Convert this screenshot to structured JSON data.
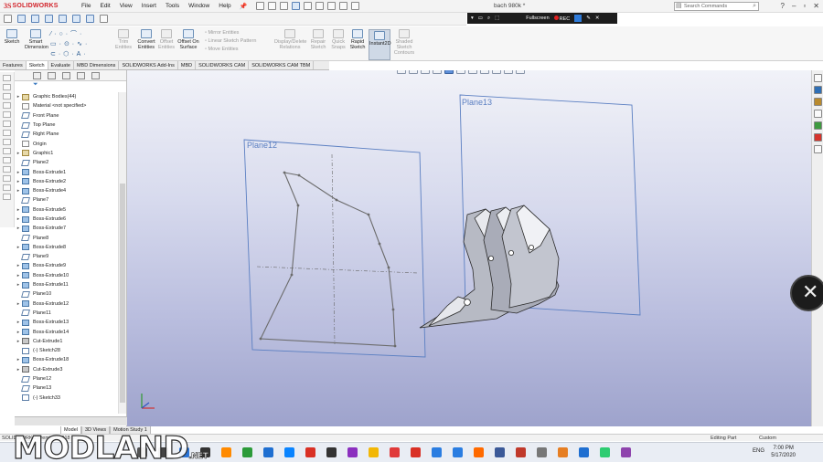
{
  "app": {
    "logo_ds": "3S",
    "logo_name": "SOLIDWORKS",
    "document_title": "bach 980k *",
    "menus": [
      "File",
      "Edit",
      "View",
      "Insert",
      "Tools",
      "Window",
      "Help"
    ],
    "search_placeholder": "Search Commands",
    "window_controls": [
      "?",
      "–",
      "▫",
      "✕"
    ]
  },
  "recorder": {
    "fullscreen_label": "Fullscreen",
    "rec_label": "REC"
  },
  "command_manager": {
    "tools": [
      {
        "id": "sketch",
        "label": "Sketch",
        "dim": false
      },
      {
        "id": "smart-dimension",
        "label": "Smart Dimension",
        "dim": false
      },
      {
        "id": "trim-entities",
        "label": "Trim Entities",
        "dim": true
      },
      {
        "id": "convert-entities",
        "label": "Convert Entities",
        "dim": false
      },
      {
        "id": "offset-entities",
        "label": "Offset Entities",
        "dim": true
      },
      {
        "id": "offset-on-surface",
        "label": "Offset On Surface",
        "dim": false
      },
      {
        "id": "display-delete-relations",
        "label": "Display/Delete Relations",
        "dim": true
      },
      {
        "id": "repair-sketch",
        "label": "Repair Sketch",
        "dim": true
      },
      {
        "id": "quick-snaps",
        "label": "Quick Snaps",
        "dim": true
      },
      {
        "id": "rapid-sketch",
        "label": "Rapid Sketch",
        "dim": false
      },
      {
        "id": "instant2d",
        "label": "Instant2D",
        "dim": false
      },
      {
        "id": "shaded-sketch-contours",
        "label": "Shaded Sketch Contours",
        "dim": true
      }
    ],
    "small_tools": [
      "Mirror Entities",
      "Linear Sketch Pattern",
      "Move Entities"
    ]
  },
  "tabs": [
    "Features",
    "Sketch",
    "Evaluate",
    "MBD Dimensions",
    "SOLIDWORKS Add-Ins",
    "MBD",
    "SOLIDWORKS CAM",
    "SOLIDWORKS CAM TBM"
  ],
  "active_tab": "Sketch",
  "feature_tree": [
    {
      "label": "Graphic Bodies(44)",
      "type": "bodies",
      "expand": true
    },
    {
      "label": "Material <not specified>",
      "type": "material",
      "expand": false
    },
    {
      "label": "Front Plane",
      "type": "plane",
      "expand": false
    },
    {
      "label": "Top Plane",
      "type": "plane",
      "expand": false
    },
    {
      "label": "Right Plane",
      "type": "plane",
      "expand": false
    },
    {
      "label": "Origin",
      "type": "origin",
      "expand": false
    },
    {
      "label": "Graphic1",
      "type": "bodies",
      "expand": true
    },
    {
      "label": "Plane2",
      "type": "plane",
      "expand": false
    },
    {
      "label": "Boss-Extrude1",
      "type": "extrude",
      "expand": true
    },
    {
      "label": "Boss-Extrude2",
      "type": "extrude",
      "expand": true
    },
    {
      "label": "Boss-Extrude4",
      "type": "extrude",
      "expand": true
    },
    {
      "label": "Plane7",
      "type": "plane",
      "expand": false
    },
    {
      "label": "Boss-Extrude5",
      "type": "extrude",
      "expand": true
    },
    {
      "label": "Boss-Extrude6",
      "type": "extrude",
      "expand": true
    },
    {
      "label": "Boss-Extrude7",
      "type": "extrude",
      "expand": true
    },
    {
      "label": "Plane8",
      "type": "plane",
      "expand": false
    },
    {
      "label": "Boss-Extrude8",
      "type": "extrude",
      "expand": true
    },
    {
      "label": "Plane9",
      "type": "plane",
      "expand": false
    },
    {
      "label": "Boss-Extrude9",
      "type": "extrude",
      "expand": true
    },
    {
      "label": "Boss-Extrude10",
      "type": "extrude",
      "expand": true
    },
    {
      "label": "Boss-Extrude11",
      "type": "extrude",
      "expand": true
    },
    {
      "label": "Plane10",
      "type": "plane",
      "expand": false
    },
    {
      "label": "Boss-Extrude12",
      "type": "extrude",
      "expand": true
    },
    {
      "label": "Plane11",
      "type": "plane",
      "expand": false
    },
    {
      "label": "Boss-Extrude13",
      "type": "extrude",
      "expand": true
    },
    {
      "label": "Boss-Extrude14",
      "type": "extrude",
      "expand": true
    },
    {
      "label": "Cut-Extrude1",
      "type": "cut",
      "expand": true
    },
    {
      "label": "(-) Sketch28",
      "type": "sketch",
      "expand": false
    },
    {
      "label": "Boss-Extrude18",
      "type": "extrude",
      "expand": true
    },
    {
      "label": "Cut-Extrude3",
      "type": "cut",
      "expand": true
    },
    {
      "label": "Plane12",
      "type": "plane",
      "expand": false
    },
    {
      "label": "Plane13",
      "type": "plane",
      "expand": false
    },
    {
      "label": "(-) Sketch33",
      "type": "sketch",
      "expand": false
    }
  ],
  "viewport": {
    "plane12_label": "Plane12",
    "plane13_label": "Plane13",
    "view_controls": [
      "–",
      "▫",
      "✕"
    ]
  },
  "model_tabs": [
    "Model",
    "3D Views",
    "Motion Study 1"
  ],
  "status": {
    "left": "SOLIDWORKS Premium 2018 x64",
    "editing": "Editing Part",
    "units": "Custom"
  },
  "taskbar": {
    "language": "ENG",
    "time": "7:00 PM",
    "date": "5/17/2020"
  },
  "watermark": {
    "text": "MODLAND",
    "suffix": ".NET"
  }
}
